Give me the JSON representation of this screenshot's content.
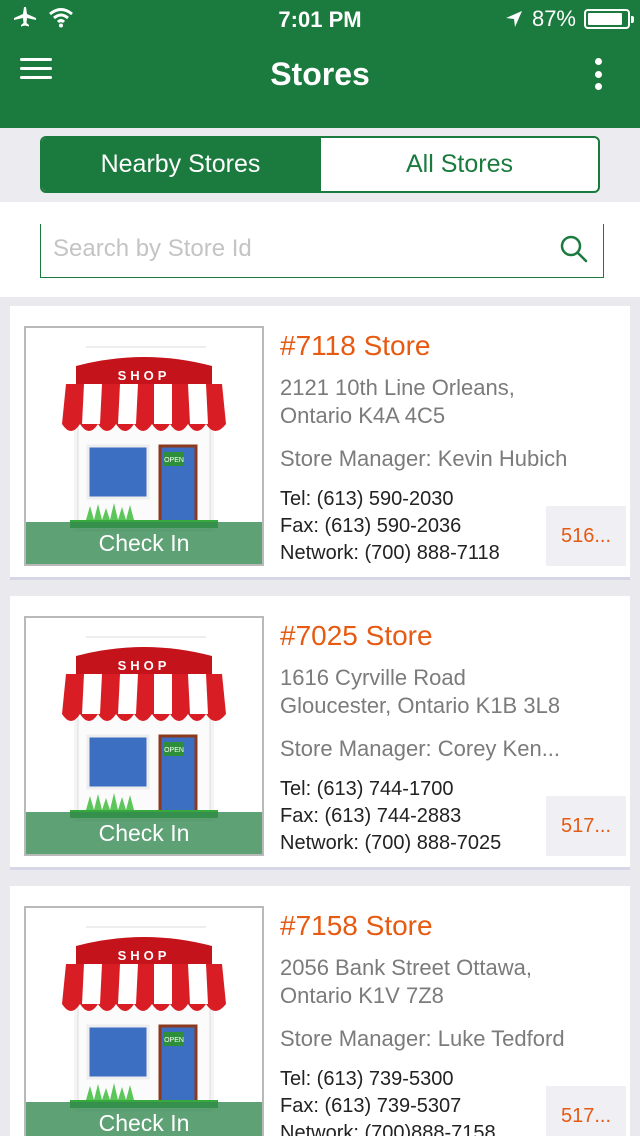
{
  "status_bar": {
    "time": "7:01 PM",
    "battery": "87%"
  },
  "header": {
    "title": "Stores"
  },
  "segments": {
    "nearby": "Nearby Stores",
    "all": "All Stores"
  },
  "search": {
    "placeholder": "Search by Store Id",
    "value": ""
  },
  "stores": [
    {
      "name": "#7118 Store",
      "address_line1": "2121 10th Line Orleans,",
      "address_line2": "Ontario K4A 4C5",
      "manager": "Store Manager:  Kevin Hubich",
      "tel": "Tel:  (613) 590-2030",
      "fax": "Fax:  (613) 590-2036",
      "network": "Network:  (700) 888-7118",
      "side": "516...",
      "checkin": "Check In",
      "shop_sign": "SHOP",
      "open_sign": "OPEN"
    },
    {
      "name": "#7025 Store",
      "address_line1": "1616 Cyrville Road",
      "address_line2": "Gloucester, Ontario K1B 3L8",
      "manager": "Store Manager:  Corey Ken...",
      "tel": "Tel:  (613) 744-1700",
      "fax": "Fax:  (613) 744-2883",
      "network": "Network:  (700) 888-7025",
      "side": "517...",
      "checkin": "Check In",
      "shop_sign": "SHOP",
      "open_sign": "OPEN"
    },
    {
      "name": "#7158 Store",
      "address_line1": "2056 Bank Street Ottawa,",
      "address_line2": "Ontario K1V 7Z8",
      "manager": "Store Manager:  Luke Tedford",
      "tel": "Tel:  (613) 739-5300",
      "fax": "Fax:  (613) 739-5307",
      "network": "Network:  (700)888-7158",
      "side": "517...",
      "checkin": "Check In",
      "shop_sign": "SHOP",
      "open_sign": "OPEN"
    }
  ]
}
